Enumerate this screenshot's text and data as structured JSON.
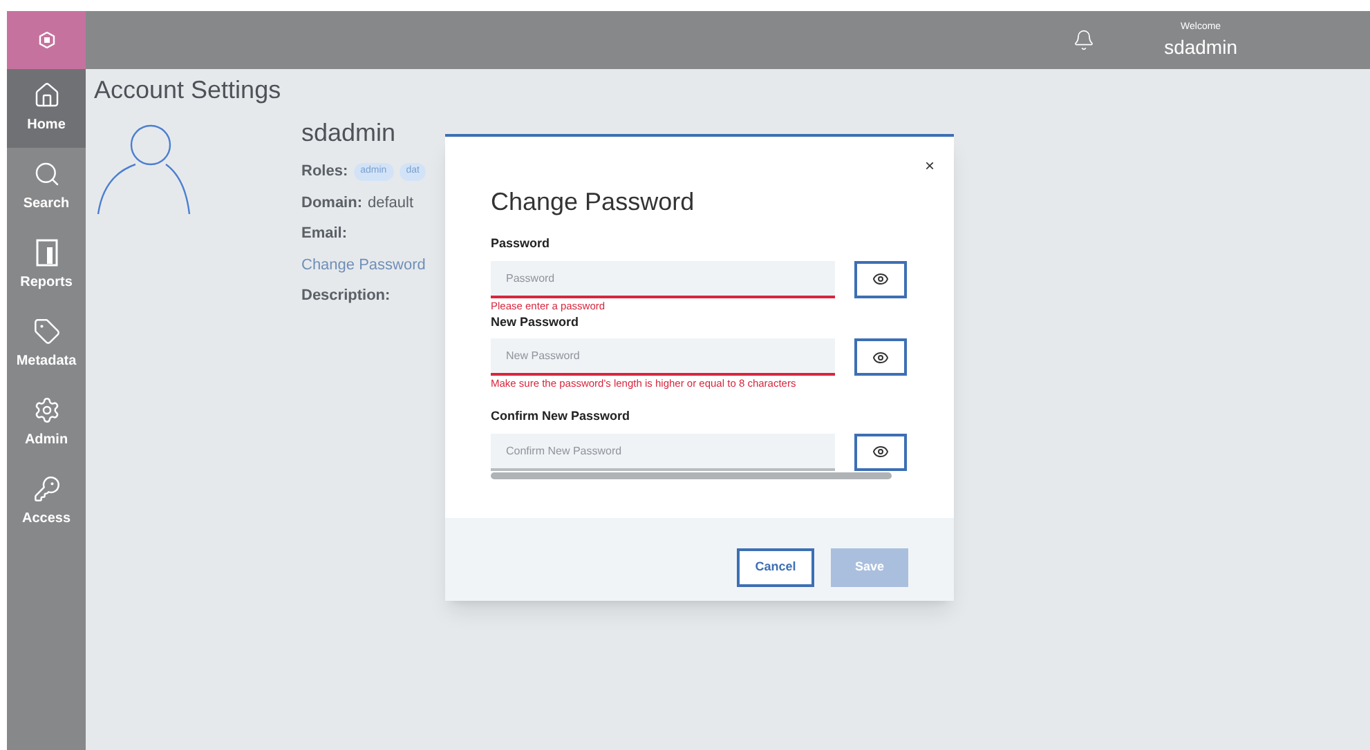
{
  "header": {
    "welcome": "Welcome",
    "user": "sdadmin"
  },
  "sidebar": {
    "items": [
      {
        "label": "Home",
        "kind": "home",
        "selected": true
      },
      {
        "label": "Search",
        "kind": "search",
        "selected": false
      },
      {
        "label": "Reports",
        "kind": "reports",
        "selected": false
      },
      {
        "label": "Metadata",
        "kind": "tag",
        "selected": false
      },
      {
        "label": "Admin",
        "kind": "gear",
        "selected": false
      },
      {
        "label": "Access",
        "kind": "key",
        "selected": false
      }
    ]
  },
  "page": {
    "title": "Account Settings",
    "username": "sdadmin",
    "roles_label": "Roles:",
    "roles": [
      "admin",
      "dat"
    ],
    "domain_label": "Domain:",
    "domain": "default",
    "email_label": "Email:",
    "change_password_link": "Change Password",
    "description_label": "Description:"
  },
  "dialog": {
    "title": "Change Password",
    "close": "×",
    "fields": [
      {
        "label": "Password",
        "placeholder": "Password",
        "error": "Please enter a password"
      },
      {
        "label": "New Password",
        "placeholder": "New Password",
        "error": "Make sure the password's length is higher or equal to 8 characters"
      },
      {
        "label": "Confirm New Password",
        "placeholder": "Confirm New Password"
      }
    ],
    "buttons": [
      {
        "label": "Cancel",
        "kind": "secondary",
        "disabled": false
      },
      {
        "label": "Save",
        "kind": "primary",
        "disabled": true
      }
    ]
  }
}
